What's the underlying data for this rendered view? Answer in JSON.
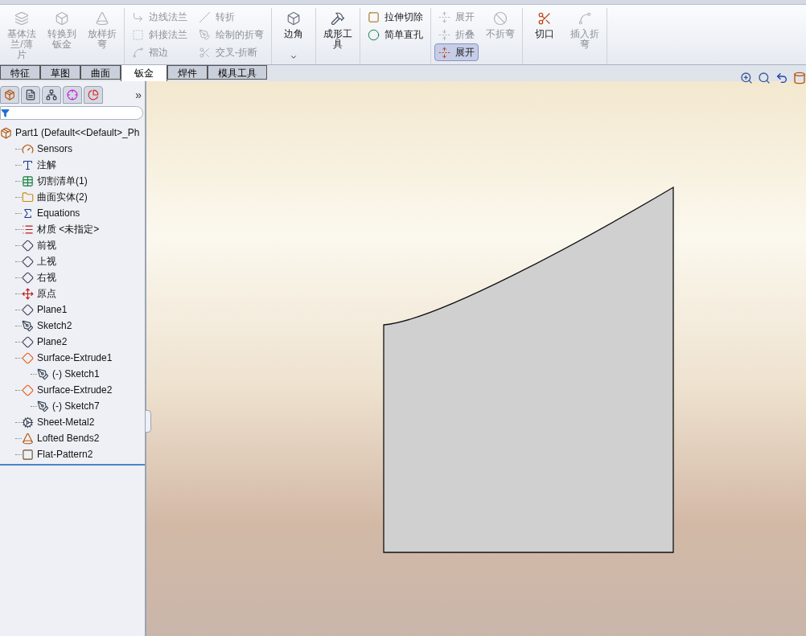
{
  "toolbar": {
    "groups": [
      {
        "entries": [
          {
            "kind": "large",
            "label": "基体法兰/薄片",
            "disabled": true,
            "pressed": false
          },
          {
            "kind": "large",
            "label": "转换到钣金",
            "disabled": true,
            "pressed": false
          },
          {
            "kind": "large",
            "label": "放样折弯",
            "disabled": true,
            "pressed": false
          }
        ]
      },
      {
        "entries": [
          {
            "kind": "stack",
            "items": [
              {
                "label": "边线法兰",
                "disabled": true,
                "pressed": false
              },
              {
                "label": "斜接法兰",
                "disabled": true,
                "pressed": false
              },
              {
                "label": "褶边",
                "disabled": true,
                "pressed": false
              }
            ]
          },
          {
            "kind": "stack",
            "items": [
              {
                "label": "转折",
                "disabled": true,
                "pressed": false
              },
              {
                "label": "绘制的折弯",
                "disabled": true,
                "pressed": false
              },
              {
                "label": "交叉-折断",
                "disabled": true,
                "pressed": false
              }
            ]
          }
        ]
      },
      {
        "entries": [
          {
            "kind": "large",
            "label": "边角",
            "disabled": false,
            "pressed": false,
            "dropdown": true
          }
        ]
      },
      {
        "entries": [
          {
            "kind": "large",
            "label": "成形工具",
            "disabled": false,
            "pressed": false
          }
        ]
      },
      {
        "entries": [
          {
            "kind": "stack",
            "items": [
              {
                "label": "拉伸切除",
                "disabled": false,
                "pressed": false
              },
              {
                "label": "简单直孔",
                "disabled": false,
                "pressed": false
              }
            ]
          }
        ]
      },
      {
        "entries": [
          {
            "kind": "stack",
            "items": [
              {
                "label": "展开",
                "disabled": true,
                "pressed": false
              },
              {
                "label": "折叠",
                "disabled": true,
                "pressed": false
              },
              {
                "label": "展开",
                "disabled": false,
                "pressed": true
              }
            ]
          },
          {
            "kind": "large",
            "label": "不折弯",
            "disabled": true,
            "pressed": false
          }
        ]
      },
      {
        "entries": [
          {
            "kind": "large",
            "label": "切口",
            "disabled": false,
            "pressed": false
          },
          {
            "kind": "large",
            "label": "插入折弯",
            "disabled": true,
            "pressed": false
          }
        ]
      }
    ]
  },
  "command_tabs": [
    {
      "label": "特征",
      "selected": false
    },
    {
      "label": "草图",
      "selected": false
    },
    {
      "label": "曲面",
      "selected": false
    },
    {
      "label": "钣金",
      "selected": true
    },
    {
      "label": "焊件",
      "selected": false
    },
    {
      "label": "模具工具",
      "selected": false
    }
  ],
  "panel": {
    "more": "»",
    "tree": {
      "label": "Part1  (Default<<Default>_Ph",
      "kind": "part",
      "children": [
        {
          "label": "Sensors",
          "kind": "sensor"
        },
        {
          "label": "注解",
          "kind": "note"
        },
        {
          "label": "切割清单(1)",
          "kind": "cutlist"
        },
        {
          "label": "曲面实体(2)",
          "kind": "bodies"
        },
        {
          "label": "Equations",
          "kind": "equations"
        },
        {
          "label": "材质 <未指定>",
          "kind": "material"
        },
        {
          "label": "前视",
          "kind": "plane"
        },
        {
          "label": "上视",
          "kind": "plane"
        },
        {
          "label": "右视",
          "kind": "plane"
        },
        {
          "label": "原点",
          "kind": "origin"
        },
        {
          "label": "Plane1",
          "kind": "plane"
        },
        {
          "label": "Sketch2",
          "kind": "sketch"
        },
        {
          "label": "Plane2",
          "kind": "plane"
        },
        {
          "label": "Surface-Extrude1",
          "kind": "surface",
          "children": [
            {
              "label": "(-) Sketch1",
              "kind": "sketch"
            }
          ]
        },
        {
          "label": "Surface-Extrude2",
          "kind": "surface",
          "children": [
            {
              "label": "(-) Sketch7",
              "kind": "sketch"
            }
          ]
        },
        {
          "label": "Sheet-Metal2",
          "kind": "sheetmetal"
        },
        {
          "label": "Lofted Bends2",
          "kind": "loft"
        },
        {
          "label": "Flat-Pattern2",
          "kind": "flat"
        }
      ]
    }
  }
}
